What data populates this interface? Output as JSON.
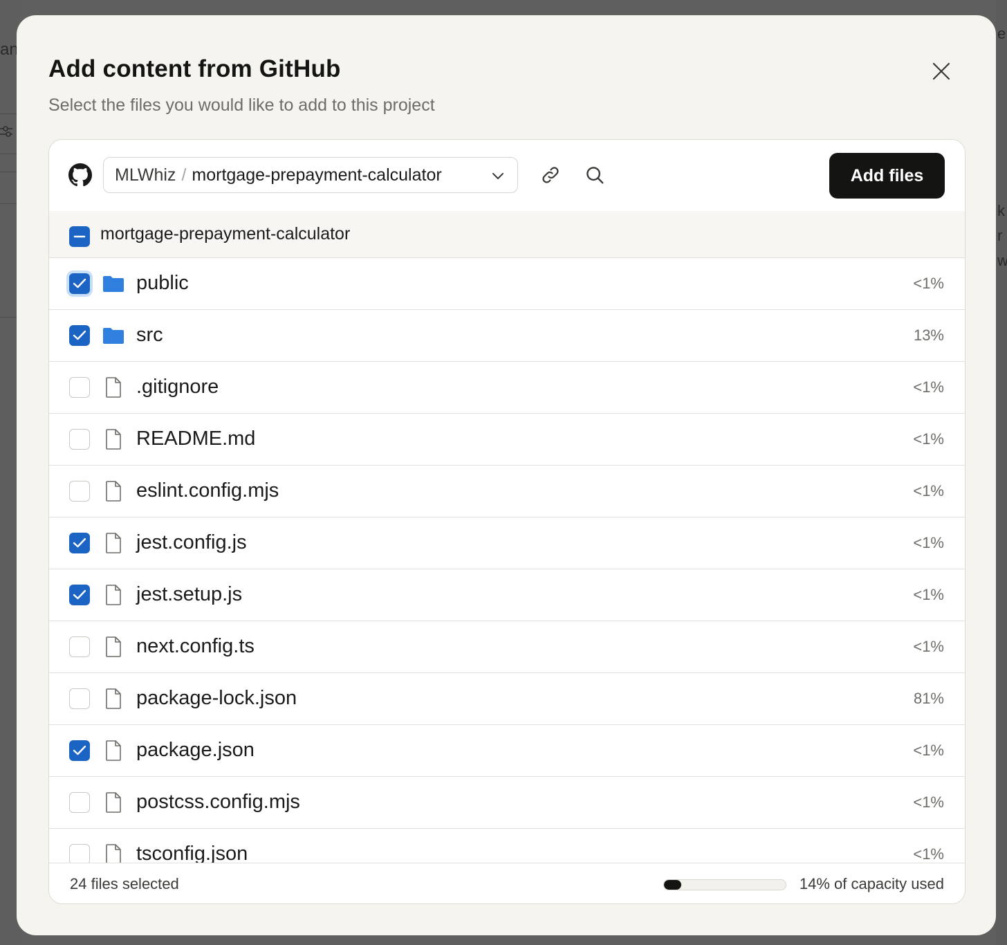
{
  "modal": {
    "title": "Add content from GitHub",
    "subtitle": "Select the files you would like to add to this project"
  },
  "toolbar": {
    "repo_owner": "MLWhiz",
    "repo_sep": "/",
    "repo_name": "mortgage-prepayment-calculator",
    "add_files_label": "Add files"
  },
  "root": {
    "label": "mortgage-prepayment-calculator",
    "state": "indeterminate"
  },
  "files": [
    {
      "name": "public",
      "type": "folder",
      "checked": true,
      "focused": true,
      "pct": "<1%"
    },
    {
      "name": "src",
      "type": "folder",
      "checked": true,
      "pct": "13%"
    },
    {
      "name": ".gitignore",
      "type": "file",
      "checked": false,
      "pct": "<1%"
    },
    {
      "name": "README.md",
      "type": "file",
      "checked": false,
      "pct": "<1%"
    },
    {
      "name": "eslint.config.mjs",
      "type": "file",
      "checked": false,
      "pct": "<1%"
    },
    {
      "name": "jest.config.js",
      "type": "file",
      "checked": true,
      "pct": "<1%"
    },
    {
      "name": "jest.setup.js",
      "type": "file",
      "checked": true,
      "pct": "<1%"
    },
    {
      "name": "next.config.ts",
      "type": "file",
      "checked": false,
      "pct": "<1%"
    },
    {
      "name": "package-lock.json",
      "type": "file",
      "checked": false,
      "pct": "81%"
    },
    {
      "name": "package.json",
      "type": "file",
      "checked": true,
      "pct": "<1%"
    },
    {
      "name": "postcss.config.mjs",
      "type": "file",
      "checked": false,
      "pct": "<1%"
    },
    {
      "name": "tsconfig.json",
      "type": "file",
      "checked": false,
      "pct": "<1%"
    }
  ],
  "footer": {
    "selected_text": "24 files selected",
    "capacity_percent": 14,
    "capacity_text": "14% of capacity used"
  },
  "colors": {
    "accent": "#1b64c4",
    "folder": "#2f7fde",
    "primary_button": "#141413"
  },
  "icons": {
    "close": "close-icon",
    "github": "github-icon",
    "chevron": "chevron-down-icon",
    "link": "link-icon",
    "search": "search-icon",
    "folder": "folder-icon",
    "file": "file-icon"
  },
  "background": {
    "left_glyph": "an",
    "right_glyphs": [
      "e",
      "k",
      "r",
      "w"
    ]
  }
}
